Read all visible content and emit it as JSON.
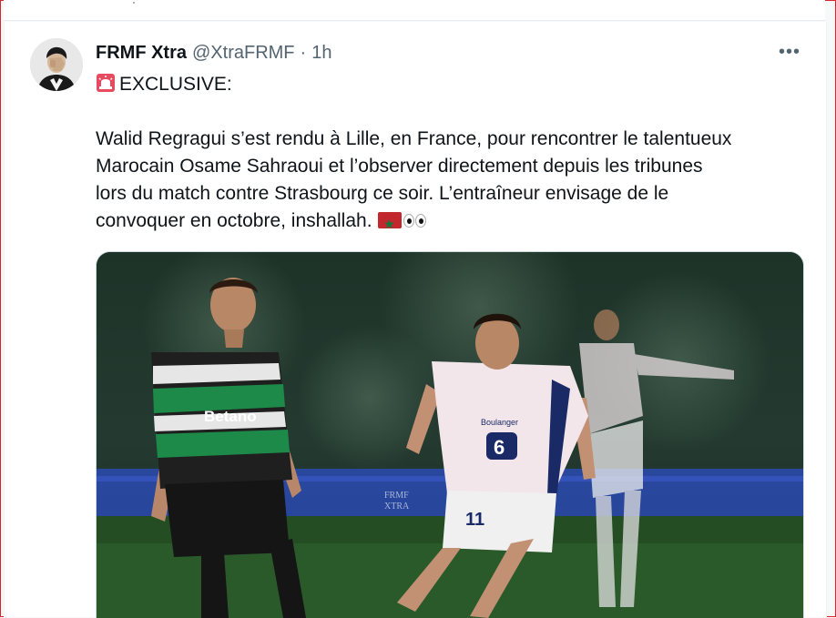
{
  "tweet": {
    "display_name": "FRMF Xtra",
    "handle": "@XtraFRMF",
    "separator": "·",
    "time": "1h",
    "more_label": "•••",
    "exclusive": "EXCLUSIVE:",
    "body_line_1": "Walid Regragui s’est rendu à Lille, en France, pour rencontrer le talentueux",
    "body_line_2": "Marocain Osame Sahraoui et l’observer directement depuis les tribunes",
    "body_line_3": "lors du match contre Strasbourg ce soir. L’entraîneur envisage de le",
    "body_line_4": "convoquer en octobre, inshallah."
  },
  "media": {
    "watermark_line_1": "FRMF",
    "watermark_line_2": "XTRA",
    "sponsor_green": "Betano",
    "sponsor_white": "6",
    "shirt_number": "11",
    "partner_text": "Boulanger"
  },
  "icons": [
    "siren-icon",
    "morocco-flag-icon",
    "eyes-icon",
    "more-icon"
  ],
  "colors": {
    "text": "#0f1419",
    "secondary": "#536471",
    "frame": "#d9242b"
  }
}
